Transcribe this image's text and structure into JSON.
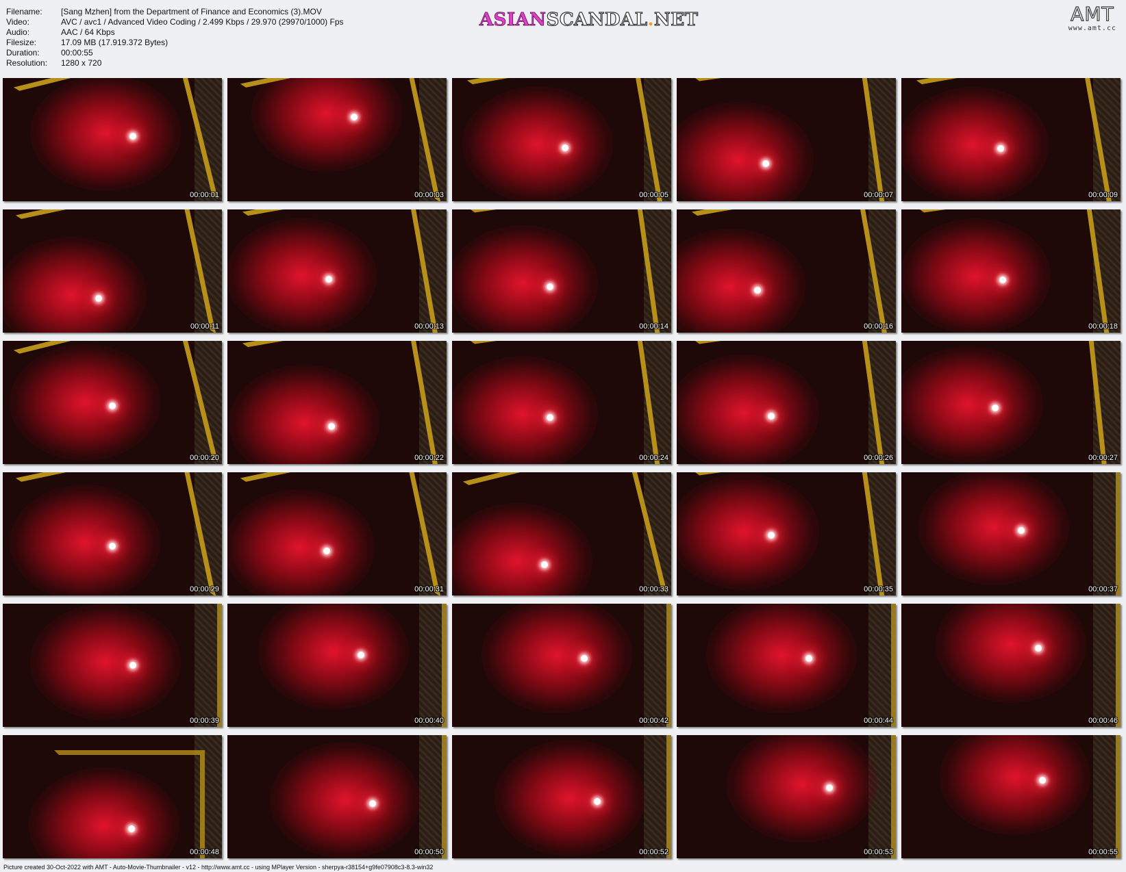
{
  "meta": {
    "filename_label": "Filename:",
    "filename": "[Sang Mzhen] from the Department of Finance and Economics (3).MOV",
    "video_label": "Video:",
    "video": "AVC / avc1 / Advanced Video Coding / 2.499 Kbps / 29.970 (29970/1000) Fps",
    "audio_label": "Audio:",
    "audio": "AAC / 64 Kbps",
    "filesize_label": "Filesize:",
    "filesize": "17.09 MB (17.919.372 Bytes)",
    "duration_label": "Duration:",
    "duration": "00:00:55",
    "resolution_label": "Resolution:",
    "resolution": "1280 x 720"
  },
  "logo": {
    "asian": "ASIAN",
    "scandal": "SCANDAL",
    "dot": ".",
    "net": "NET"
  },
  "amt_logo": {
    "title": "AMT",
    "url": "www.amt.cc"
  },
  "thumbnails": [
    "00:00:01",
    "00:00:03",
    "00:00:05",
    "00:00:07",
    "00:00:09",
    "00:00:11",
    "00:00:13",
    "00:00:14",
    "00:00:16",
    "00:00:18",
    "00:00:20",
    "00:00:22",
    "00:00:24",
    "00:00:26",
    "00:00:27",
    "00:00:29",
    "00:00:31",
    "00:00:33",
    "00:00:35",
    "00:00:37",
    "00:00:39",
    "00:00:40",
    "00:00:42",
    "00:00:44",
    "00:00:46",
    "00:00:48",
    "00:00:50",
    "00:00:52",
    "00:00:53",
    "00:00:55"
  ],
  "footer": "Picture created 30-Oct-2022 with AMT - Auto-Movie-Thumbnailer - v12 - http://www.amt.cc - using MPlayer Version - sherpya-r38154+g9fe07908c3-8.3-win32",
  "colors": {
    "background": "#eef0f3",
    "frame": "#b7901a",
    "red_glow": "#eb142d"
  }
}
